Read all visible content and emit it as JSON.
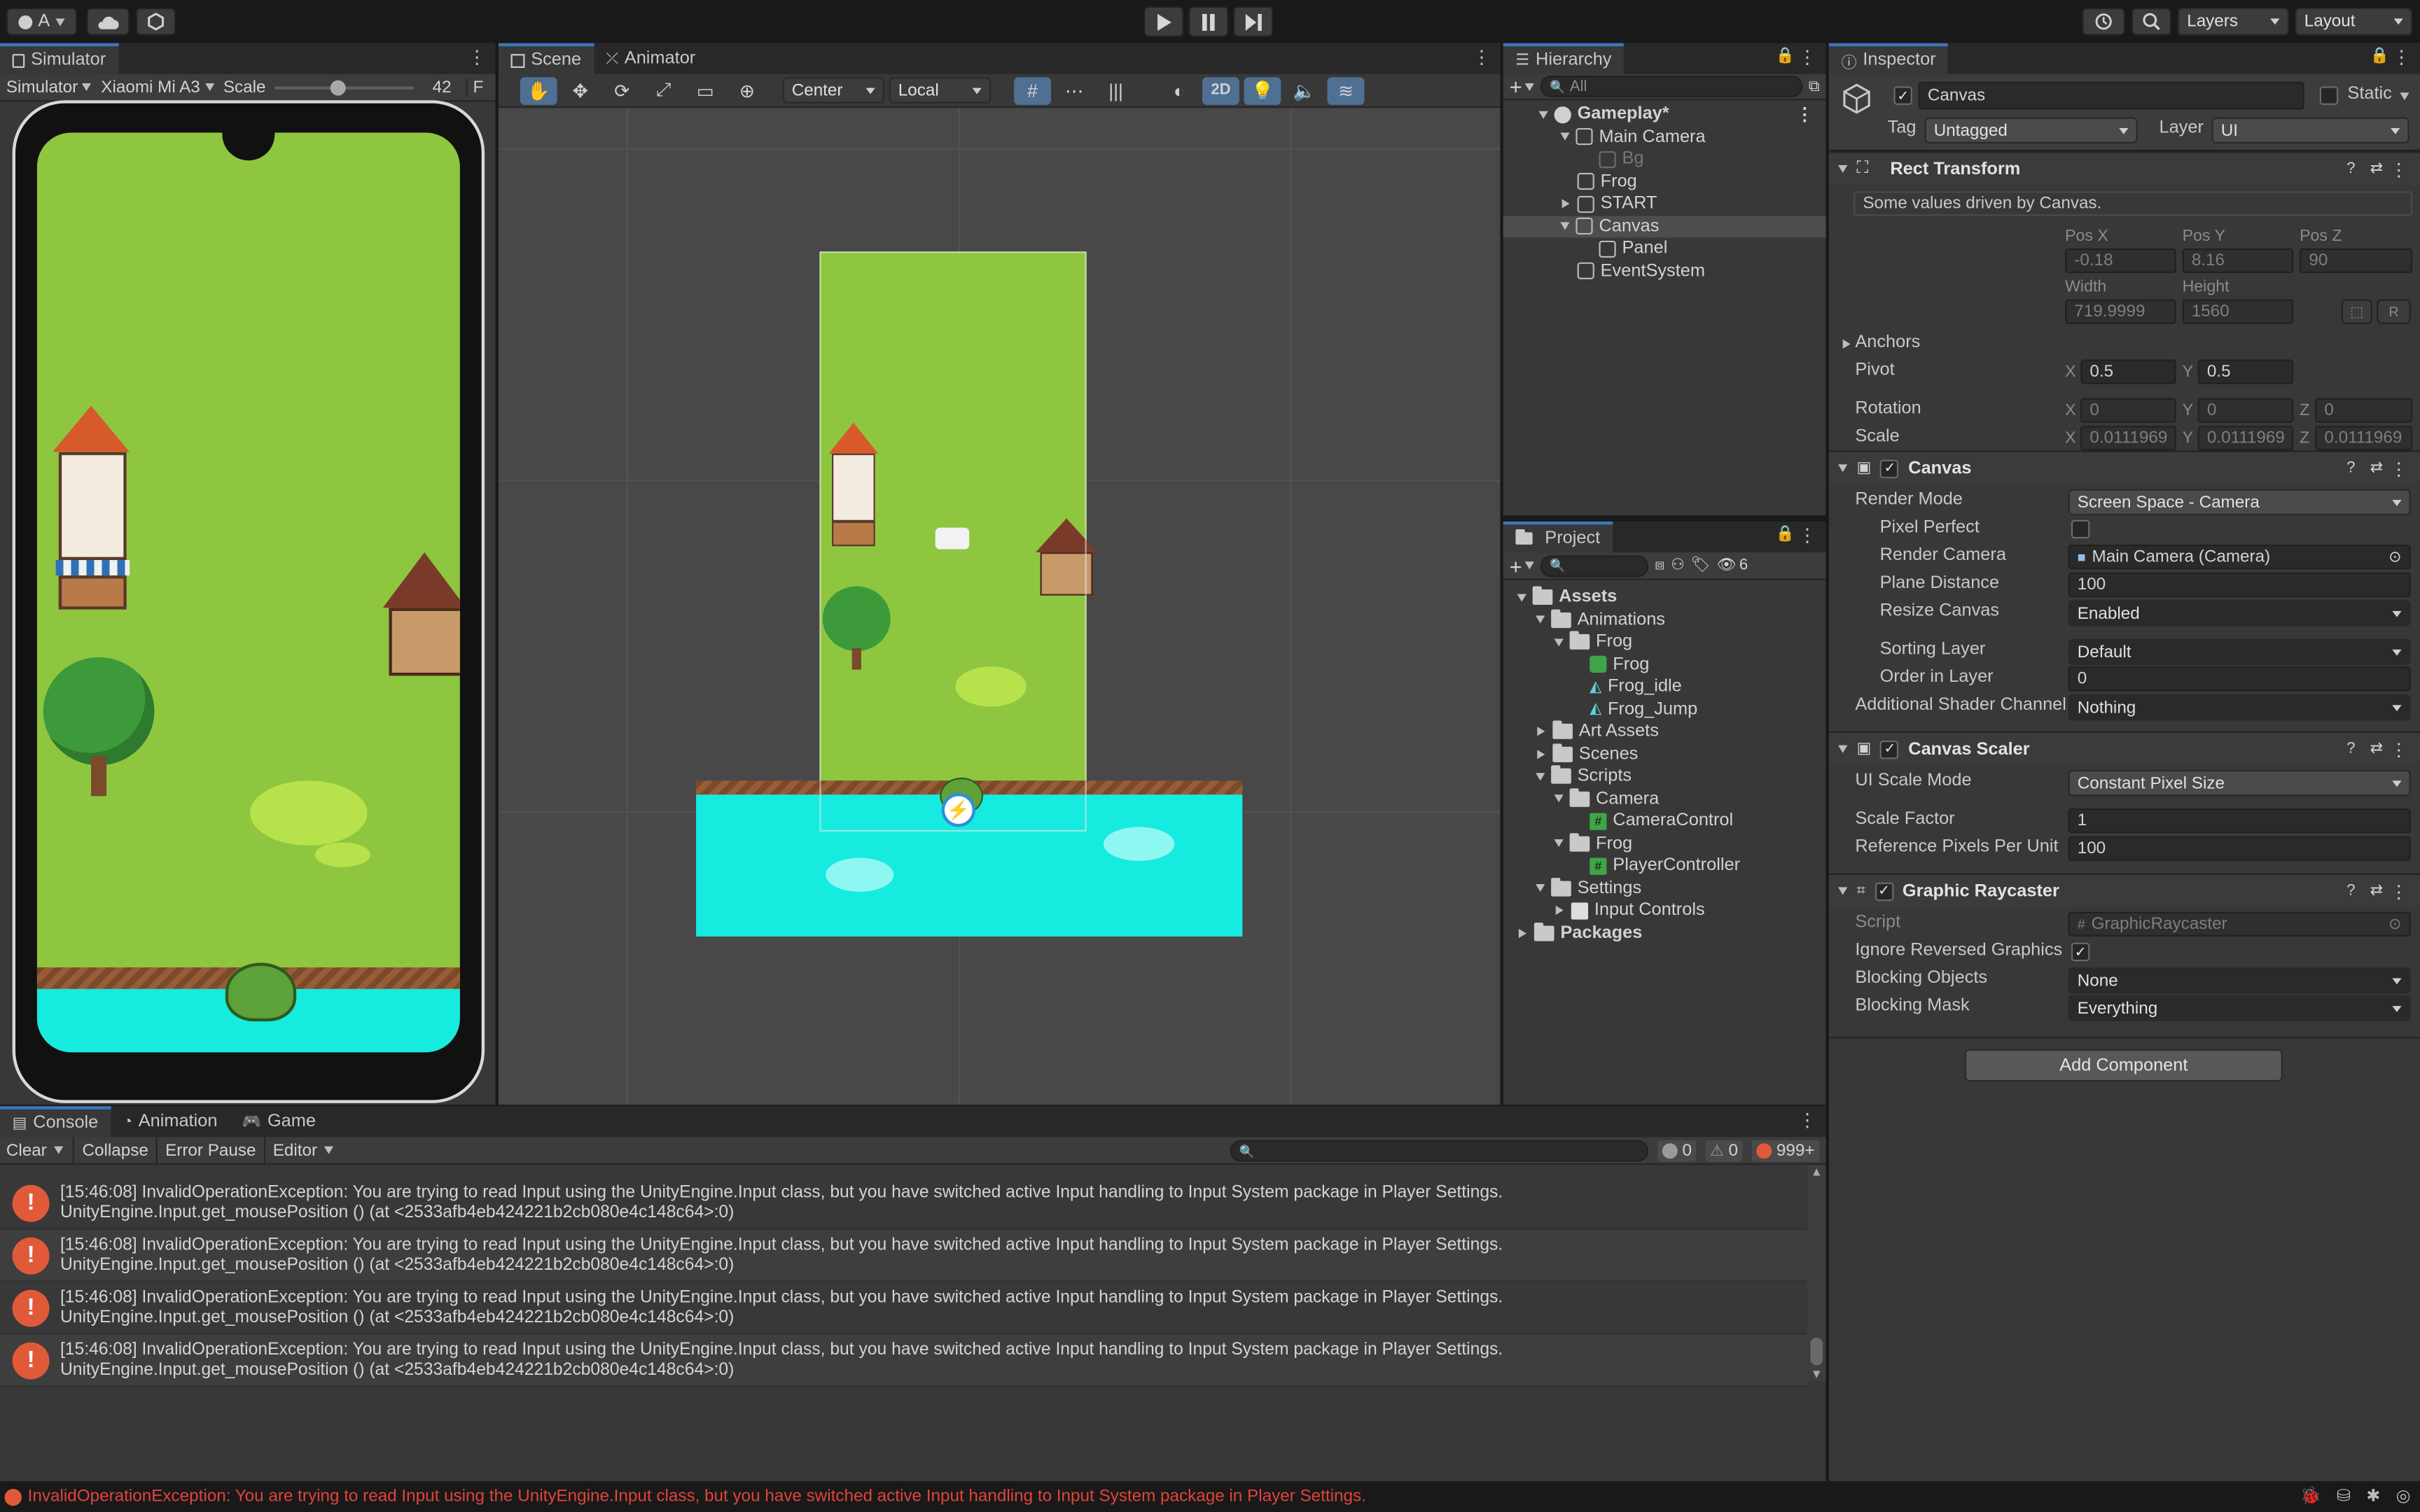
{
  "topbar": {
    "account_label": "A",
    "layers_label": "Layers",
    "layout_label": "Layout"
  },
  "simulator": {
    "tab_label": "Simulator",
    "mode_label": "Simulator",
    "device_label": "Xiaomi Mi A3",
    "scale_label": "Scale",
    "scale_value": "42",
    "scale_fraction": 0.45,
    "extra_label": "F"
  },
  "scene": {
    "tabs": [
      "Scene",
      "Animator"
    ],
    "pivot_label": "Center",
    "space_label": "Local",
    "mode_2d": "2D"
  },
  "hierarchy": {
    "tab_label": "Hierarchy",
    "search_placeholder": "All",
    "items": [
      {
        "label": "Gameplay*",
        "depth": 0,
        "type": "scene",
        "expanded": true
      },
      {
        "label": "Main Camera",
        "depth": 1,
        "type": "object",
        "expanded": true
      },
      {
        "label": "Bg",
        "depth": 2,
        "type": "object-disabled"
      },
      {
        "label": "Frog",
        "depth": 1,
        "type": "object"
      },
      {
        "label": "START",
        "depth": 1,
        "type": "object",
        "collapsed": true
      },
      {
        "label": "Canvas",
        "depth": 1,
        "type": "object",
        "expanded": true,
        "selected": true
      },
      {
        "label": "Panel",
        "depth": 2,
        "type": "object"
      },
      {
        "label": "EventSystem",
        "depth": 1,
        "type": "object"
      }
    ]
  },
  "project": {
    "tab_label": "Project",
    "hidden_count": "6",
    "items": [
      {
        "label": "Assets",
        "depth": 0,
        "type": "folder",
        "expanded": true,
        "bold": true
      },
      {
        "label": "Animations",
        "depth": 1,
        "type": "folder",
        "expanded": true
      },
      {
        "label": "Frog",
        "depth": 2,
        "type": "folder",
        "expanded": true
      },
      {
        "label": "Frog",
        "depth": 3,
        "type": "animator"
      },
      {
        "label": "Frog_idle",
        "depth": 3,
        "type": "anim"
      },
      {
        "label": "Frog_Jump",
        "depth": 3,
        "type": "anim"
      },
      {
        "label": "Art Assets",
        "depth": 1,
        "type": "folder",
        "collapsed": true
      },
      {
        "label": "Scenes",
        "depth": 1,
        "type": "folder",
        "collapsed": true
      },
      {
        "label": "Scripts",
        "depth": 1,
        "type": "folder",
        "expanded": true
      },
      {
        "label": "Camera",
        "depth": 2,
        "type": "folder",
        "expanded": true
      },
      {
        "label": "CameraControl",
        "depth": 3,
        "type": "script"
      },
      {
        "label": "Frog",
        "depth": 2,
        "type": "folder",
        "expanded": true
      },
      {
        "label": "PlayerController",
        "depth": 3,
        "type": "script"
      },
      {
        "label": "Settings",
        "depth": 1,
        "type": "folder",
        "expanded": true
      },
      {
        "label": "Input Controls",
        "depth": 2,
        "type": "input",
        "collapsed": true
      },
      {
        "label": "Packages",
        "depth": 0,
        "type": "folder",
        "collapsed": true,
        "bold": true
      }
    ]
  },
  "inspector": {
    "tab_label": "Inspector",
    "object_name": "Canvas",
    "static_label": "Static",
    "tag_label": "Tag",
    "tag_value": "Untagged",
    "layer_label": "Layer",
    "layer_value": "UI",
    "rect": {
      "title": "Rect Transform",
      "note": "Some values driven by Canvas.",
      "posx_label": "Pos X",
      "posy_label": "Pos Y",
      "posz_label": "Pos Z",
      "posx": "-0.18",
      "posy": "8.16",
      "posz": "90",
      "width_label": "Width",
      "height_label": "Height",
      "width": "719.9999",
      "height": "1560",
      "r_label": "R",
      "anchors_label": "Anchors",
      "pivot_label": "Pivot",
      "pivot_x": "0.5",
      "pivot_y": "0.5",
      "rotation_label": "Rotation",
      "rot_x": "0",
      "rot_y": "0",
      "rot_z": "0",
      "scale_label": "Scale",
      "scale_x": "0.0111969",
      "scale_y": "0.0111969",
      "scale_z": "0.0111969",
      "x": "X",
      "y": "Y",
      "z": "Z"
    },
    "canvas": {
      "title": "Canvas",
      "render_mode_label": "Render Mode",
      "render_mode": "Screen Space - Camera",
      "pixel_perfect_label": "Pixel Perfect",
      "render_camera_label": "Render Camera",
      "render_camera": "Main Camera (Camera)",
      "plane_distance_label": "Plane Distance",
      "plane_distance": "100",
      "resize_label": "Resize Canvas",
      "resize": "Enabled",
      "sorting_layer_label": "Sorting Layer",
      "sorting_layer": "Default",
      "order_label": "Order in Layer",
      "order": "0",
      "shader_label": "Additional Shader Channel",
      "shader": "Nothing"
    },
    "scaler": {
      "title": "Canvas Scaler",
      "mode_label": "UI Scale Mode",
      "mode": "Constant Pixel Size",
      "factor_label": "Scale Factor",
      "factor": "1",
      "ref_label": "Reference Pixels Per Unit",
      "ref": "100"
    },
    "raycaster": {
      "title": "Graphic Raycaster",
      "script_label": "Script",
      "script": "GraphicRaycaster",
      "ignore_label": "Ignore Reversed Graphics",
      "blocking_label": "Blocking Objects",
      "blocking": "None",
      "mask_label": "Blocking Mask",
      "mask": "Everything"
    },
    "add_component": "Add Component"
  },
  "console": {
    "tabs": [
      "Console",
      "Animation",
      "Game"
    ],
    "clear_label": "Clear",
    "collapse_label": "Collapse",
    "error_pause_label": "Error Pause",
    "editor_label": "Editor",
    "log_count": "0",
    "warn_count": "0",
    "error_count": "999+",
    "entries": [
      {
        "line1": "[15:46:08] InvalidOperationException: You are trying to read Input using the UnityEngine.Input class, but you have switched active Input handling to Input System package in Player Settings.",
        "line2": "UnityEngine.Input.get_mousePosition () (at <2533afb4eb424221b2cb080e4c148c64>:0)"
      },
      {
        "line1": "[15:46:08] InvalidOperationException: You are trying to read Input using the UnityEngine.Input class, but you have switched active Input handling to Input System package in Player Settings.",
        "line2": "UnityEngine.Input.get_mousePosition () (at <2533afb4eb424221b2cb080e4c148c64>:0)"
      },
      {
        "line1": "[15:46:08] InvalidOperationException: You are trying to read Input using the UnityEngine.Input class, but you have switched active Input handling to Input System package in Player Settings.",
        "line2": "UnityEngine.Input.get_mousePosition () (at <2533afb4eb424221b2cb080e4c148c64>:0)"
      },
      {
        "line1": "[15:46:08] InvalidOperationException: You are trying to read Input using the UnityEngine.Input class, but you have switched active Input handling to Input System package in Player Settings.",
        "line2": "UnityEngine.Input.get_mousePosition () (at <2533afb4eb424221b2cb080e4c148c64>:0)"
      }
    ]
  },
  "statusbar": {
    "message": "InvalidOperationException: You are trying to read Input using the UnityEngine.Input class, but you have switched active Input handling to Input System package in Player Settings."
  },
  "colors": {
    "accent": "#3a79bb",
    "error": "#e05a3a",
    "grass": "#8ec63f",
    "water": "#16ebe0",
    "status_error_text": "#e0443a"
  }
}
